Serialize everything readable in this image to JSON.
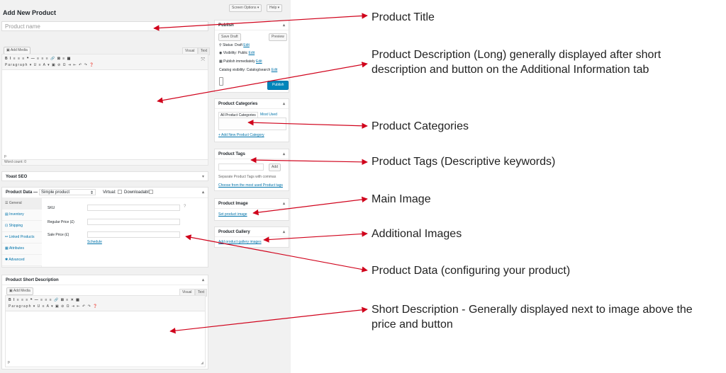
{
  "page": {
    "title": "Add New Product",
    "screen_options": "Screen Options ▾",
    "help": "Help ▾"
  },
  "title_field": {
    "placeholder": "Product name"
  },
  "description_editor": {
    "add_media": "Add Media",
    "tab_visual": "Visual",
    "tab_text": "Text",
    "toolbar_row1": "B  I  ≡  ≡  ≡  ❝  —  ≡  ≡  ≡  🔗  ⊠  ≡  ▦",
    "toolbar_row2": "Paragraph  ▾  U  ≡  A ▾  ▣  ⊘  Ω  ⇥  ⇤  ↶  ↷  ❓",
    "path": "p",
    "word_count": "Word count: 0"
  },
  "yoast": {
    "title": "Yoast SEO"
  },
  "product_data": {
    "title": "Product Data —",
    "type_select": "Simple product",
    "virtual": "Virtual:",
    "downloadable": "Downloadable:",
    "tabs": [
      "General",
      "Inventory",
      "Shipping",
      "Linked Products",
      "Attributes",
      "Advanced"
    ],
    "sku_label": "SKU",
    "regular_price_label": "Regular Price (£)",
    "sale_price_label": "Sale Price (£)",
    "schedule": "Schedule"
  },
  "short_description": {
    "title": "Product Short Description",
    "add_media": "Add Media",
    "tab_visual": "Visual",
    "tab_text": "Text",
    "toolbar_row1": "B  I  ≡  ≡  ≡  ❝  —  ≡  ≡  ≡  🔗  ⊠  ≡  ✕  ▦",
    "toolbar_row2": "Paragraph  ▾  U  ≡  A ▾  ▣  ⊘  Ω  ⇥  ⇤  ↶  ↷  ❓",
    "path": "p"
  },
  "publish": {
    "title": "Publish",
    "save_draft": "Save Draft",
    "preview": "Preview",
    "status": "Status: Draft",
    "visibility": "Visibility: Public",
    "publish_when": "Publish immediately",
    "catalog_visibility": "Catalog visibility: Catalog/search",
    "edit": "Edit",
    "publish_button": "Publish"
  },
  "categories": {
    "title": "Product Categories",
    "tab_all": "All Product Categories",
    "tab_used": "Most Used",
    "add_new": "+ Add New Product Category"
  },
  "tags": {
    "title": "Product Tags",
    "add": "Add",
    "separate": "Separate Product Tags with commas",
    "choose": "Choose from the most used Product tags"
  },
  "image": {
    "title": "Product Image",
    "set": "Set product image"
  },
  "gallery": {
    "title": "Product Gallery",
    "add": "Add product gallery images"
  },
  "annotations": {
    "title": "Product Title",
    "description": "Product Description (Long) generally displayed after short description and button on the Additional Information tab",
    "categories": "Product Categories",
    "tags": "Product Tags (Descriptive keywords)",
    "main_image": "Main Image",
    "additional_images": "Additional Images",
    "product_data": "Product Data (configuring your product)",
    "short_description": "Short Description - Generally displayed next to image above the price and button"
  },
  "colors": {
    "arrow": "#d0021b",
    "link": "#0073aa",
    "primary": "#0085ba"
  },
  "icons": [
    "caret-up-icon",
    "pin-icon",
    "eye-icon",
    "calendar-icon",
    "media-icon",
    "wrench-icon",
    "circle-help-icon"
  ]
}
